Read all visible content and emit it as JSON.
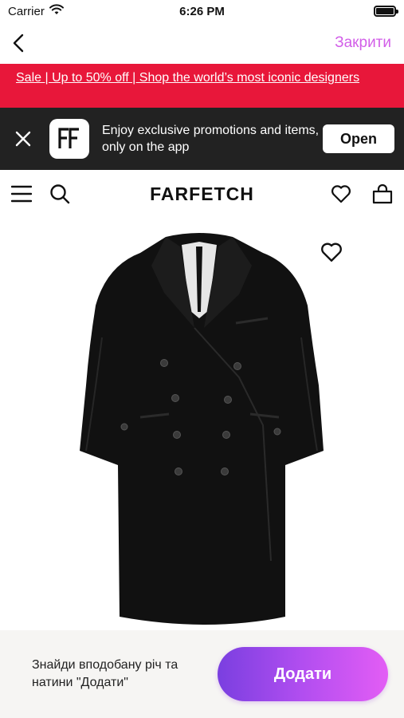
{
  "status_bar": {
    "carrier": "Carrier",
    "time": "6:26 PM",
    "battery_level": 1.0
  },
  "nav": {
    "close_label": "Закрити"
  },
  "sale_banner": {
    "text": "Sale | Up to 50% off | Shop the world’s most iconic designers"
  },
  "app_banner": {
    "message": "Enjoy exclusive promotions and items, only on the app",
    "open_label": "Open"
  },
  "header": {
    "brand": "FARFETCH"
  },
  "bottom": {
    "hint_line1": "Знайди вподобану річ та",
    "hint_line2": "натини \"Додати\"",
    "add_label": "Додати"
  },
  "colors": {
    "accent": "#d25ee8",
    "sale_red": "#e8173a",
    "app_banner_bg": "#222222",
    "gradient_start": "#7a3fe0",
    "gradient_end": "#e35df5"
  },
  "icons": [
    "wifi-icon",
    "battery-icon",
    "back-chevron-icon",
    "close-icon",
    "farfetch-logo-icon",
    "menu-icon",
    "search-icon",
    "heart-icon",
    "shopping-bag-icon"
  ]
}
